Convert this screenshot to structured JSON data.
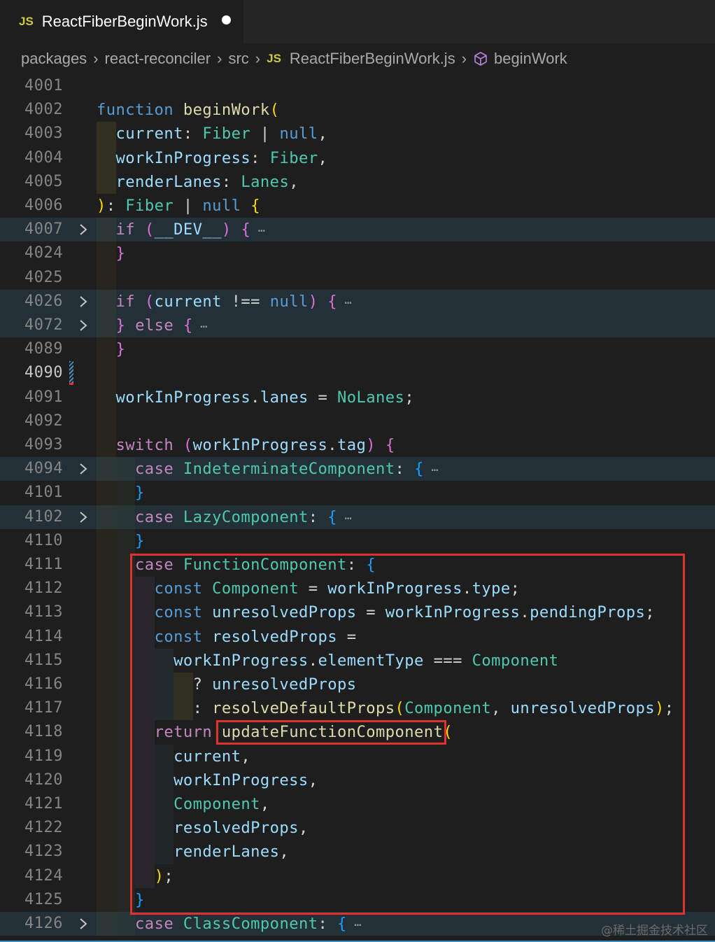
{
  "tab": {
    "icon_label": "JS",
    "file_name": "ReactFiberBeginWork.js",
    "modified_icon": "unsaved-dot-icon"
  },
  "breadcrumb": {
    "parts": [
      "packages",
      "react-reconciler",
      "src"
    ],
    "file_icon_label": "JS",
    "file": "ReactFiberBeginWork.js",
    "symbol_icon": "cube-icon",
    "symbol": "beginWork",
    "separator_icon": "chevron-right-icon"
  },
  "lines": [
    {
      "n": "4001",
      "t": []
    },
    {
      "n": "4002",
      "t": [
        [
          "kw",
          "function"
        ],
        [
          "pun",
          " "
        ],
        [
          "fn",
          "beginWork"
        ],
        [
          "br1",
          "("
        ]
      ]
    },
    {
      "n": "4003",
      "t": [
        [
          "pun",
          "  "
        ],
        [
          "var",
          "current"
        ],
        [
          "pun",
          ": "
        ],
        [
          "typ",
          "Fiber"
        ],
        [
          "pun",
          " | "
        ],
        [
          "kw",
          "null"
        ],
        [
          "pun",
          ","
        ]
      ]
    },
    {
      "n": "4004",
      "t": [
        [
          "pun",
          "  "
        ],
        [
          "var",
          "workInProgress"
        ],
        [
          "pun",
          ": "
        ],
        [
          "typ",
          "Fiber"
        ],
        [
          "pun",
          ","
        ]
      ]
    },
    {
      "n": "4005",
      "t": [
        [
          "pun",
          "  "
        ],
        [
          "var",
          "renderLanes"
        ],
        [
          "pun",
          ": "
        ],
        [
          "typ",
          "Lanes"
        ],
        [
          "pun",
          ","
        ]
      ]
    },
    {
      "n": "4006",
      "t": [
        [
          "br1",
          ")"
        ],
        [
          "pun",
          ": "
        ],
        [
          "typ",
          "Fiber"
        ],
        [
          "pun",
          " | "
        ],
        [
          "kw",
          "null"
        ],
        [
          "pun",
          " "
        ],
        [
          "br1",
          "{"
        ]
      ]
    },
    {
      "n": "4007",
      "t": [
        [
          "pun",
          "  "
        ],
        [
          "ctl",
          "if"
        ],
        [
          "pun",
          " "
        ],
        [
          "br2",
          "("
        ],
        [
          "var",
          "__DEV__"
        ],
        [
          "br2",
          ")"
        ],
        [
          "pun",
          " "
        ],
        [
          "br2",
          "{"
        ],
        [
          "ell",
          " ⋯"
        ]
      ]
    },
    {
      "n": "4024",
      "t": [
        [
          "pun",
          "  "
        ],
        [
          "br2",
          "}"
        ]
      ]
    },
    {
      "n": "4025",
      "t": []
    },
    {
      "n": "4026",
      "t": [
        [
          "pun",
          "  "
        ],
        [
          "ctl",
          "if"
        ],
        [
          "pun",
          " "
        ],
        [
          "br2",
          "("
        ],
        [
          "var",
          "current"
        ],
        [
          "pun",
          " !== "
        ],
        [
          "kw",
          "null"
        ],
        [
          "br2",
          ")"
        ],
        [
          "pun",
          " "
        ],
        [
          "br2",
          "{"
        ],
        [
          "ell",
          " ⋯"
        ]
      ]
    },
    {
      "n": "4072",
      "t": [
        [
          "pun",
          "  "
        ],
        [
          "br2",
          "}"
        ],
        [
          "pun",
          " "
        ],
        [
          "ctl",
          "else"
        ],
        [
          "pun",
          " "
        ],
        [
          "br2",
          "{"
        ],
        [
          "ell",
          " ⋯"
        ]
      ]
    },
    {
      "n": "4089",
      "t": [
        [
          "pun",
          "  "
        ],
        [
          "br2",
          "}"
        ]
      ]
    },
    {
      "n": "4090",
      "t": []
    },
    {
      "n": "4091",
      "t": [
        [
          "pun",
          "  "
        ],
        [
          "var",
          "workInProgress"
        ],
        [
          "pun",
          "."
        ],
        [
          "var",
          "lanes"
        ],
        [
          "pun",
          " = "
        ],
        [
          "typ",
          "NoLanes"
        ],
        [
          "pun",
          ";"
        ]
      ]
    },
    {
      "n": "4092",
      "t": []
    },
    {
      "n": "4093",
      "t": [
        [
          "pun",
          "  "
        ],
        [
          "ctl",
          "switch"
        ],
        [
          "pun",
          " "
        ],
        [
          "br2",
          "("
        ],
        [
          "var",
          "workInProgress"
        ],
        [
          "pun",
          "."
        ],
        [
          "var",
          "tag"
        ],
        [
          "br2",
          ")"
        ],
        [
          "pun",
          " "
        ],
        [
          "br2",
          "{"
        ]
      ]
    },
    {
      "n": "4094",
      "t": [
        [
          "pun",
          "    "
        ],
        [
          "ctl",
          "case"
        ],
        [
          "pun",
          " "
        ],
        [
          "typ",
          "IndeterminateComponent"
        ],
        [
          "pun",
          ": "
        ],
        [
          "br3",
          "{"
        ],
        [
          "ell",
          " ⋯"
        ]
      ]
    },
    {
      "n": "4101",
      "t": [
        [
          "pun",
          "    "
        ],
        [
          "br3",
          "}"
        ]
      ]
    },
    {
      "n": "4102",
      "t": [
        [
          "pun",
          "    "
        ],
        [
          "ctl",
          "case"
        ],
        [
          "pun",
          " "
        ],
        [
          "typ",
          "LazyComponent"
        ],
        [
          "pun",
          ": "
        ],
        [
          "br3",
          "{"
        ],
        [
          "ell",
          " ⋯"
        ]
      ]
    },
    {
      "n": "4110",
      "t": [
        [
          "pun",
          "    "
        ],
        [
          "br3",
          "}"
        ]
      ]
    },
    {
      "n": "4111",
      "t": [
        [
          "pun",
          "    "
        ],
        [
          "ctl",
          "case"
        ],
        [
          "pun",
          " "
        ],
        [
          "typ",
          "FunctionComponent"
        ],
        [
          "pun",
          ": "
        ],
        [
          "br3",
          "{"
        ]
      ]
    },
    {
      "n": "4112",
      "t": [
        [
          "pun",
          "      "
        ],
        [
          "kw",
          "const"
        ],
        [
          "pun",
          " "
        ],
        [
          "typ",
          "Component"
        ],
        [
          "pun",
          " = "
        ],
        [
          "var",
          "workInProgress"
        ],
        [
          "pun",
          "."
        ],
        [
          "var",
          "type"
        ],
        [
          "pun",
          ";"
        ]
      ]
    },
    {
      "n": "4113",
      "t": [
        [
          "pun",
          "      "
        ],
        [
          "kw",
          "const"
        ],
        [
          "pun",
          " "
        ],
        [
          "var",
          "unresolvedProps"
        ],
        [
          "pun",
          " = "
        ],
        [
          "var",
          "workInProgress"
        ],
        [
          "pun",
          "."
        ],
        [
          "var",
          "pendingProps"
        ],
        [
          "pun",
          ";"
        ]
      ]
    },
    {
      "n": "4114",
      "t": [
        [
          "pun",
          "      "
        ],
        [
          "kw",
          "const"
        ],
        [
          "pun",
          " "
        ],
        [
          "var",
          "resolvedProps"
        ],
        [
          "pun",
          " ="
        ]
      ]
    },
    {
      "n": "4115",
      "t": [
        [
          "pun",
          "        "
        ],
        [
          "var",
          "workInProgress"
        ],
        [
          "pun",
          "."
        ],
        [
          "var",
          "elementType"
        ],
        [
          "pun",
          " === "
        ],
        [
          "typ",
          "Component"
        ]
      ]
    },
    {
      "n": "4116",
      "t": [
        [
          "pun",
          "          ? "
        ],
        [
          "var",
          "unresolvedProps"
        ]
      ]
    },
    {
      "n": "4117",
      "t": [
        [
          "pun",
          "          : "
        ],
        [
          "fn",
          "resolveDefaultProps"
        ],
        [
          "br1",
          "("
        ],
        [
          "typ",
          "Component"
        ],
        [
          "pun",
          ", "
        ],
        [
          "var",
          "unresolvedProps"
        ],
        [
          "br1",
          ")"
        ],
        [
          "pun",
          ";"
        ]
      ]
    },
    {
      "n": "4118",
      "t": [
        [
          "pun",
          "      "
        ],
        [
          "ctl",
          "return"
        ],
        [
          "pun",
          " "
        ],
        [
          "fn",
          "updateFunctionComponent"
        ],
        [
          "br1",
          "("
        ]
      ]
    },
    {
      "n": "4119",
      "t": [
        [
          "pun",
          "        "
        ],
        [
          "var",
          "current"
        ],
        [
          "pun",
          ","
        ]
      ]
    },
    {
      "n": "4120",
      "t": [
        [
          "pun",
          "        "
        ],
        [
          "var",
          "workInProgress"
        ],
        [
          "pun",
          ","
        ]
      ]
    },
    {
      "n": "4121",
      "t": [
        [
          "pun",
          "        "
        ],
        [
          "typ",
          "Component"
        ],
        [
          "pun",
          ","
        ]
      ]
    },
    {
      "n": "4122",
      "t": [
        [
          "pun",
          "        "
        ],
        [
          "var",
          "resolvedProps"
        ],
        [
          "pun",
          ","
        ]
      ]
    },
    {
      "n": "4123",
      "t": [
        [
          "pun",
          "        "
        ],
        [
          "var",
          "renderLanes"
        ],
        [
          "pun",
          ","
        ]
      ]
    },
    {
      "n": "4124",
      "t": [
        [
          "pun",
          "      "
        ],
        [
          "br1",
          ")"
        ],
        [
          "pun",
          ";"
        ]
      ]
    },
    {
      "n": "4125",
      "t": [
        [
          "pun",
          "    "
        ],
        [
          "br3",
          "}"
        ]
      ]
    },
    {
      "n": "4126",
      "t": [
        [
          "pun",
          "    "
        ],
        [
          "ctl",
          "case"
        ],
        [
          "pun",
          " "
        ],
        [
          "typ",
          "ClassComponent"
        ],
        [
          "pun",
          ": "
        ],
        [
          "br3",
          "{"
        ],
        [
          "ell",
          " ⋯"
        ]
      ]
    }
  ],
  "folded_lines": [
    "4007",
    "4026",
    "4072",
    "4094",
    "4102",
    "4126"
  ],
  "current_line": "4090",
  "highlight_color": "#e03131",
  "watermark": "@稀土掘金技术社区"
}
